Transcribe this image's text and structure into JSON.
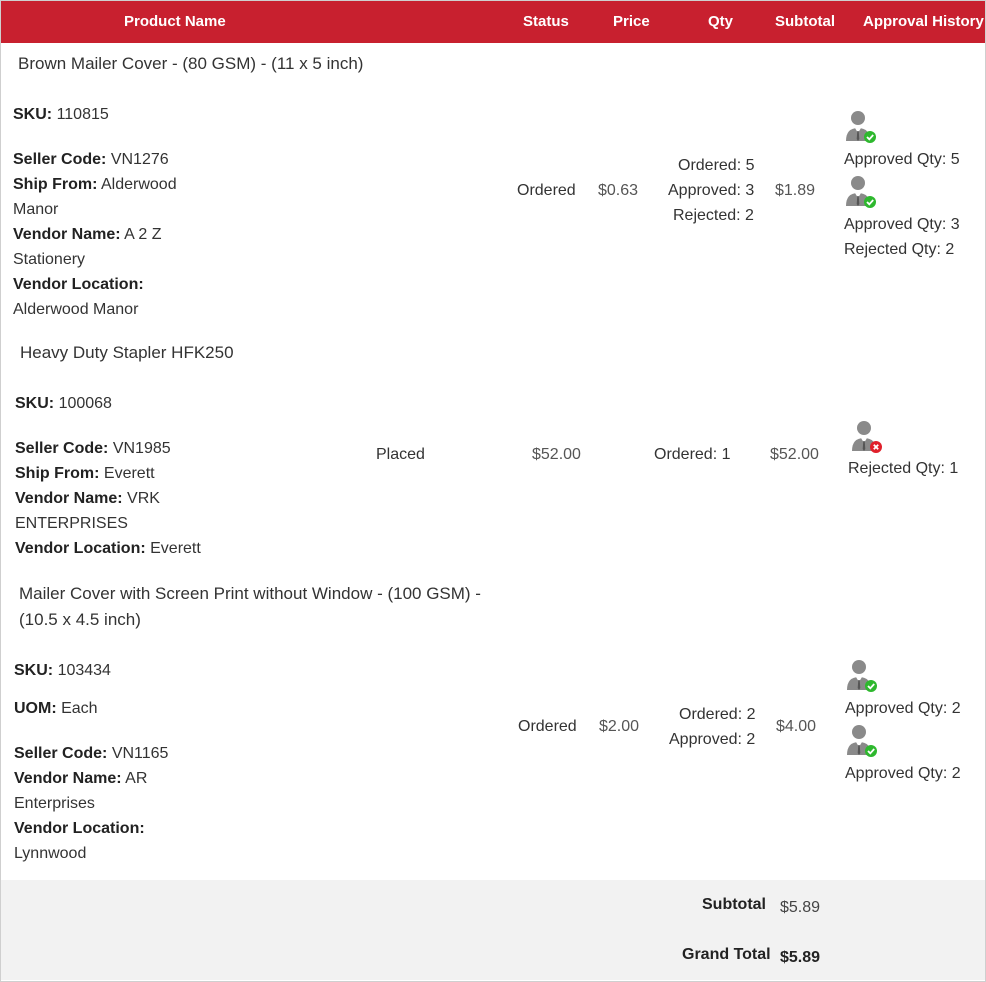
{
  "header": {
    "product_name": "Product Name",
    "status": "Status",
    "price": "Price",
    "qty": "Qty",
    "subtotal": "Subtotal",
    "approval_history": "Approval History"
  },
  "colors": {
    "header_bg": "#c8202f",
    "approved_badge": "#2eb82e",
    "rejected_badge": "#e0202b",
    "totals_bg": "#f2f2f2"
  },
  "labels": {
    "sku": "SKU:",
    "seller_code": "Seller Code:",
    "ship_from": "Ship From:",
    "vendor_name": "Vendor Name:",
    "vendor_location": "Vendor Location:",
    "uom": "UOM:"
  },
  "items": [
    {
      "name": "Brown Mailer Cover - (80 GSM) - (11 x 5 inch)",
      "sku": "110815",
      "seller_code": "VN1276",
      "ship_from_1": "Alderwood",
      "ship_from_2": "Manor",
      "vendor_name_1": "A 2 Z",
      "vendor_name_2": "Stationery",
      "vendor_location": "Alderwood Manor",
      "status": "Ordered",
      "price": "$0.63",
      "qty": [
        "Ordered: 5",
        "Approved: 3",
        "Rejected: 2"
      ],
      "subtotal": "$1.89",
      "approvals": [
        {
          "icon": "user-approved-icon",
          "lines": [
            "Approved Qty: 5"
          ]
        },
        {
          "icon": "user-approved-icon",
          "lines": [
            "Approved Qty: 3",
            "Rejected Qty: 2"
          ]
        }
      ]
    },
    {
      "name": "Heavy Duty Stapler HFK250",
      "sku": "100068",
      "seller_code": "VN1985",
      "ship_from": "Everett",
      "vendor_name_1": "VRK",
      "vendor_name_2": "ENTERPRISES",
      "vendor_location": "Everett",
      "status": "Placed",
      "price": "$52.00",
      "qty": [
        "Ordered: 1"
      ],
      "subtotal": "$52.00",
      "approvals": [
        {
          "icon": "user-rejected-icon",
          "lines": [
            "Rejected Qty: 1"
          ]
        }
      ]
    },
    {
      "name_1": "Mailer Cover with Screen Print without Window - (100 GSM) -",
      "name_2": "(10.5 x 4.5 inch)",
      "sku": "103434",
      "uom": "Each",
      "seller_code": "VN1165",
      "vendor_name_1": "AR",
      "vendor_name_2": "Enterprises",
      "vendor_location": "Lynnwood",
      "status": "Ordered",
      "price": "$2.00",
      "qty": [
        "Ordered: 2",
        "Approved: 2"
      ],
      "subtotal": "$4.00",
      "approvals": [
        {
          "icon": "user-approved-icon",
          "lines": [
            "Approved Qty: 2"
          ]
        },
        {
          "icon": "user-approved-icon",
          "lines": [
            "Approved Qty: 2"
          ]
        }
      ]
    }
  ],
  "totals": {
    "subtotal_label": "Subtotal",
    "subtotal_value": "$5.89",
    "grand_total_label": "Grand Total",
    "grand_total_value": "$5.89"
  }
}
